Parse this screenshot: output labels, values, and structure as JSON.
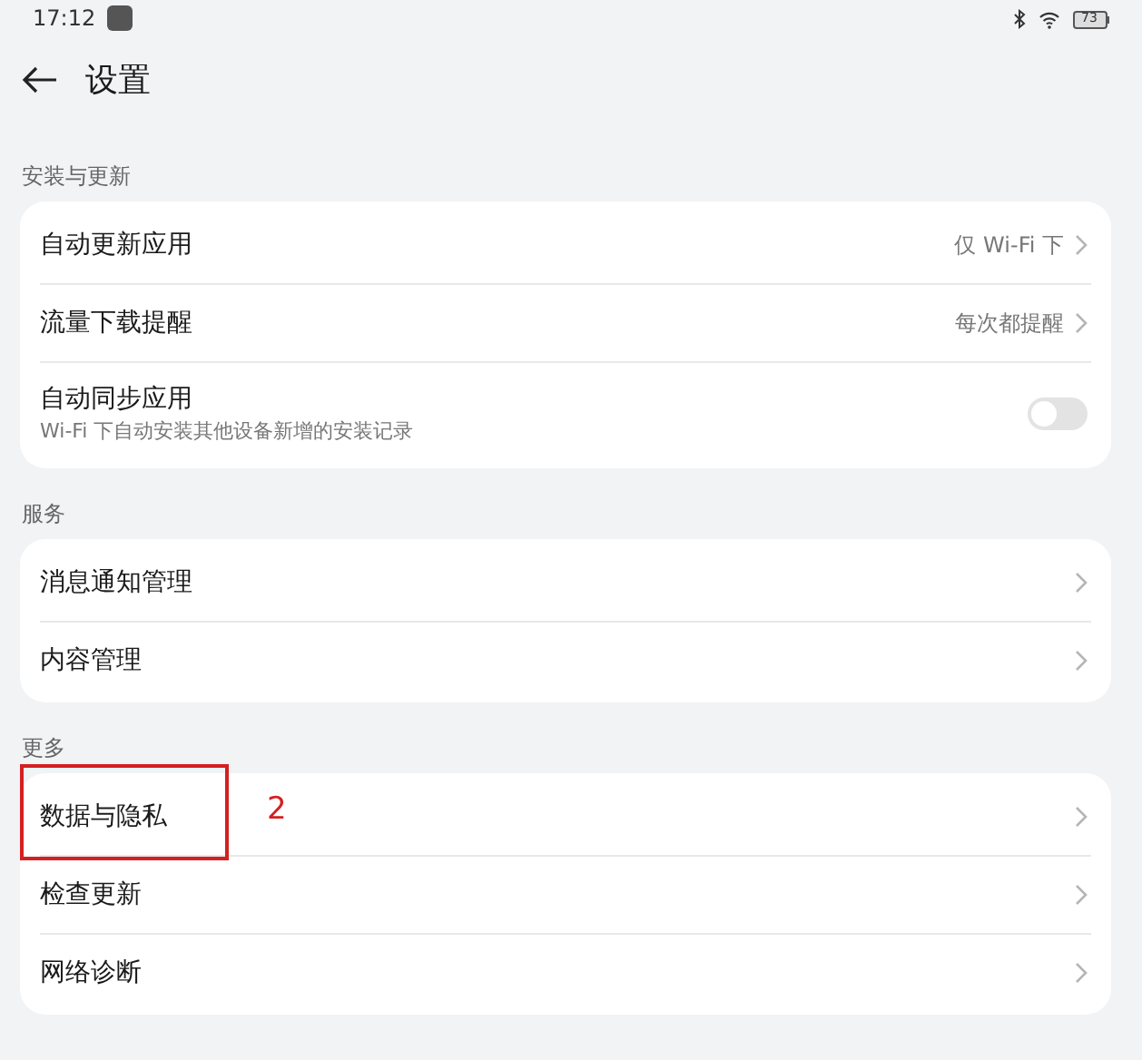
{
  "status_bar": {
    "time": "17:12",
    "battery": "73"
  },
  "header": {
    "title": "设置"
  },
  "sections": [
    {
      "title": "安装与更新",
      "items": [
        {
          "kind": "link",
          "label": "自动更新应用",
          "value": "仅 Wi-Fi 下"
        },
        {
          "kind": "link",
          "label": "流量下载提醒",
          "value": "每次都提醒"
        },
        {
          "kind": "toggle",
          "label": "自动同步应用",
          "subtitle": "Wi-Fi 下自动安装其他设备新增的安装记录",
          "on": false
        }
      ]
    },
    {
      "title": "服务",
      "items": [
        {
          "kind": "link",
          "label": "消息通知管理"
        },
        {
          "kind": "link",
          "label": "内容管理"
        }
      ]
    },
    {
      "title": "更多",
      "items": [
        {
          "kind": "link",
          "label": "数据与隐私",
          "annotation": "2"
        },
        {
          "kind": "link",
          "label": "检查更新"
        },
        {
          "kind": "link",
          "label": "网络诊断"
        }
      ]
    }
  ]
}
